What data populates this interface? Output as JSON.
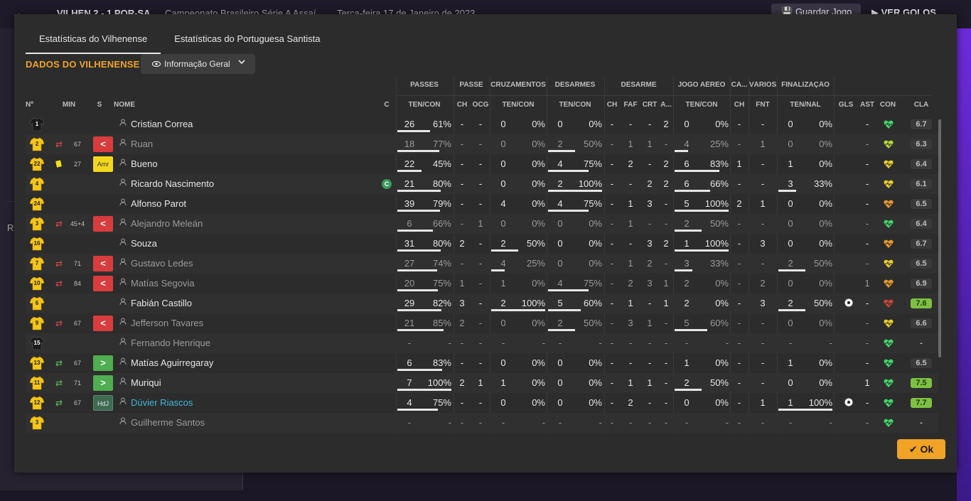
{
  "app": {
    "back_label": "←",
    "score": "VILHEN   2 - 1   POR-SA",
    "competition": "Campeonato Brasileiro Série A Assaí",
    "date": "Terça-feira 17 de Janeiro de 2023",
    "save_label": "Guardar Jogo",
    "goals_label": "VER GOLOS",
    "left_letter": "R"
  },
  "tabs": [
    "Estatísticas do Vilhenense",
    "Estatísticas do Portuguesa Santista"
  ],
  "section_title": "DADOS DO VILHENENSE",
  "view_dropdown": {
    "label": "Informação Geral",
    "icon": "eye-icon"
  },
  "groups": {
    "passes": "PASSES",
    "passe": "PASSE",
    "cruzamentos": "CRUZAMENTOS",
    "desarmes": "DESARMES",
    "desarme": "DESARME",
    "jogo_aereo": "JOGO AÉREO",
    "ca": "CA...",
    "varios": "VÁRIOS",
    "finalizacao": "FINALIZAÇÃO"
  },
  "columns": {
    "num": "Nº",
    "min": "MIN",
    "s": "S",
    "nome": "NOME",
    "c": "C",
    "pass_tc": "TEN/CON",
    "pass_ch": "CH",
    "pass_ocg": "OCG",
    "cruz_tc": "TEN/CON",
    "des_tc": "TEN/CON",
    "des_ch": "CH",
    "des_faf": "FAF",
    "des_crt": "CRT",
    "des_a": "A...",
    "aer_tc": "TEN/CON",
    "ca_ch": "CH",
    "var_fnt": "FNT",
    "fin_tn": "TEN/NAL",
    "gls": "GLS",
    "ast": "AST",
    "con": "CON",
    "cla": "CLA"
  },
  "rows": [
    {
      "num": "1",
      "gk": true,
      "sub": "",
      "min": "",
      "badge": "",
      "badge_label": "",
      "name": "Cristian Correa",
      "c": "",
      "dim": false,
      "link": false,
      "p": [
        "26",
        "61%",
        0.61
      ],
      "pch": "-",
      "pocg": "-",
      "cr": [
        "0",
        "0%",
        0
      ],
      "de": [
        "0",
        "0%",
        0
      ],
      "dch": "-",
      "faf": "-",
      "crt": "-",
      "da": "2",
      "ae": [
        "0",
        "0%",
        0
      ],
      "cach": "-",
      "fnt": "-",
      "fi": [
        "0",
        "0%",
        0
      ],
      "gls": "",
      "ast": "-",
      "con": "green",
      "cla": "6.7",
      "hi": false
    },
    {
      "num": "2",
      "gk": false,
      "sub": "out",
      "min": "67",
      "badge": "out",
      "badge_label": "<",
      "name": "Ruan",
      "c": "",
      "dim": true,
      "link": false,
      "p": [
        "18",
        "77%",
        0.77
      ],
      "pch": "-",
      "pocg": "-",
      "cr": [
        "0",
        "0%",
        0
      ],
      "de": [
        "2",
        "50%",
        0.5
      ],
      "dch": "-",
      "faf": "1",
      "crt": "1",
      "da": "-",
      "ae": [
        "4",
        "25%",
        0.25
      ],
      "cach": "-",
      "fnt": "1",
      "fi": [
        "0",
        "0%",
        0
      ],
      "gls": "",
      "ast": "-",
      "con": "yellowgreen",
      "cla": "6.3",
      "hi": false
    },
    {
      "num": "22",
      "gk": false,
      "sub": "yellow",
      "min": "27",
      "badge": "amr",
      "badge_label": "Amr",
      "name": "Bueno",
      "c": "",
      "dim": false,
      "link": false,
      "p": [
        "22",
        "45%",
        0.45
      ],
      "pch": "-",
      "pocg": "-",
      "cr": [
        "0",
        "0%",
        0
      ],
      "de": [
        "4",
        "75%",
        0.75
      ],
      "dch": "-",
      "faf": "2",
      "crt": "-",
      "da": "2",
      "ae": [
        "6",
        "83%",
        0.83
      ],
      "cach": "1",
      "fnt": "-",
      "fi": [
        "1",
        "0%",
        0
      ],
      "gls": "",
      "ast": "-",
      "con": "yellow",
      "cla": "6.4",
      "hi": false
    },
    {
      "num": "4",
      "gk": false,
      "sub": "",
      "min": "",
      "badge": "",
      "badge_label": "",
      "name": "Ricardo Nascimento",
      "c": "C",
      "dim": false,
      "link": false,
      "p": [
        "21",
        "80%",
        0.8
      ],
      "pch": "-",
      "pocg": "-",
      "cr": [
        "0",
        "0%",
        0
      ],
      "de": [
        "2",
        "100%",
        1
      ],
      "dch": "-",
      "faf": "-",
      "crt": "2",
      "da": "2",
      "ae": [
        "6",
        "66%",
        0.66
      ],
      "cach": "-",
      "fnt": "-",
      "fi": [
        "3",
        "33%",
        0.33
      ],
      "gls": "",
      "ast": "-",
      "con": "yellow",
      "cla": "6.1",
      "hi": false
    },
    {
      "num": "24",
      "gk": false,
      "sub": "",
      "min": "",
      "badge": "",
      "badge_label": "",
      "name": "Alfonso Parot",
      "c": "",
      "dim": false,
      "link": false,
      "p": [
        "39",
        "79%",
        0.79
      ],
      "pch": "-",
      "pocg": "-",
      "cr": [
        "4",
        "0%",
        0
      ],
      "de": [
        "4",
        "75%",
        0.75
      ],
      "dch": "-",
      "faf": "1",
      "crt": "3",
      "da": "-",
      "ae": [
        "5",
        "100%",
        1
      ],
      "cach": "2",
      "fnt": "1",
      "fi": [
        "0",
        "0%",
        0
      ],
      "gls": "",
      "ast": "-",
      "con": "orange",
      "cla": "6.5",
      "hi": false
    },
    {
      "num": "3",
      "gk": false,
      "sub": "out",
      "min": "45+4",
      "badge": "out",
      "badge_label": "<",
      "name": "Alejandro Meleán",
      "c": "",
      "dim": true,
      "link": false,
      "p": [
        "6",
        "66%",
        0.66
      ],
      "pch": "-",
      "pocg": "1",
      "cr": [
        "0",
        "0%",
        0
      ],
      "de": [
        "0",
        "0%",
        0
      ],
      "dch": "-",
      "faf": "1",
      "crt": "-",
      "da": "-",
      "ae": [
        "2",
        "50%",
        0.5
      ],
      "cach": "-",
      "fnt": "-",
      "fi": [
        "0",
        "0%",
        0
      ],
      "gls": "",
      "ast": "-",
      "con": "green",
      "cla": "6.4",
      "hi": false
    },
    {
      "num": "16",
      "gk": false,
      "sub": "",
      "min": "",
      "badge": "",
      "badge_label": "",
      "name": "Souza",
      "c": "",
      "dim": false,
      "link": false,
      "p": [
        "31",
        "80%",
        0.8
      ],
      "pch": "2",
      "pocg": "-",
      "cr": [
        "2",
        "50%",
        0.5
      ],
      "de": [
        "0",
        "0%",
        0
      ],
      "dch": "-",
      "faf": "-",
      "crt": "3",
      "da": "2",
      "ae": [
        "1",
        "100%",
        1
      ],
      "cach": "-",
      "fnt": "3",
      "fi": [
        "0",
        "0%",
        0
      ],
      "gls": "",
      "ast": "-",
      "con": "orange",
      "cla": "6.7",
      "hi": false
    },
    {
      "num": "7",
      "gk": false,
      "sub": "out",
      "min": "71",
      "badge": "out",
      "badge_label": "<",
      "name": "Gustavo Ledes",
      "c": "",
      "dim": true,
      "link": false,
      "p": [
        "27",
        "74%",
        0.74
      ],
      "pch": "-",
      "pocg": "-",
      "cr": [
        "4",
        "25%",
        0.25
      ],
      "de": [
        "0",
        "0%",
        0
      ],
      "dch": "-",
      "faf": "1",
      "crt": "2",
      "da": "-",
      "ae": [
        "3",
        "33%",
        0.33
      ],
      "cach": "-",
      "fnt": "-",
      "fi": [
        "2",
        "50%",
        0.5
      ],
      "gls": "",
      "ast": "-",
      "con": "yellow",
      "cla": "6.5",
      "hi": false
    },
    {
      "num": "10",
      "gk": false,
      "sub": "out",
      "min": "84",
      "badge": "out",
      "badge_label": "<",
      "name": "Matías Segovia",
      "c": "",
      "dim": true,
      "link": false,
      "p": [
        "20",
        "75%",
        0.75
      ],
      "pch": "1",
      "pocg": "-",
      "cr": [
        "1",
        "0%",
        0
      ],
      "de": [
        "4",
        "75%",
        0.75
      ],
      "dch": "-",
      "faf": "2",
      "crt": "3",
      "da": "1",
      "ae": [
        "2",
        "0%",
        0
      ],
      "cach": "-",
      "fnt": "2",
      "fi": [
        "0",
        "0%",
        0
      ],
      "gls": "",
      "ast": "1",
      "con": "orange",
      "cla": "6.9",
      "hi": false
    },
    {
      "num": "6",
      "gk": false,
      "sub": "",
      "min": "",
      "badge": "",
      "badge_label": "",
      "name": "Fabián Castillo",
      "c": "",
      "dim": false,
      "link": false,
      "p": [
        "29",
        "82%",
        0.82
      ],
      "pch": "3",
      "pocg": "-",
      "cr": [
        "2",
        "100%",
        1
      ],
      "de": [
        "5",
        "60%",
        0.6
      ],
      "dch": "-",
      "faf": "1",
      "crt": "-",
      "da": "1",
      "ae": [
        "2",
        "0%",
        0
      ],
      "cach": "-",
      "fnt": "3",
      "fi": [
        "2",
        "50%",
        0.5
      ],
      "gls": "ball",
      "ast": "-",
      "con": "red",
      "cla": "7.6",
      "hi": true
    },
    {
      "num": "9",
      "gk": false,
      "sub": "out",
      "min": "67",
      "badge": "out",
      "badge_label": "<",
      "name": "Jefferson Tavares",
      "c": "",
      "dim": true,
      "link": false,
      "p": [
        "21",
        "85%",
        0.85
      ],
      "pch": "2",
      "pocg": "-",
      "cr": [
        "0",
        "0%",
        0
      ],
      "de": [
        "2",
        "50%",
        0.5
      ],
      "dch": "-",
      "faf": "3",
      "crt": "1",
      "da": "-",
      "ae": [
        "5",
        "60%",
        0.6
      ],
      "cach": "-",
      "fnt": "-",
      "fi": [
        "0",
        "0%",
        0
      ],
      "gls": "",
      "ast": "-",
      "con": "yellow",
      "cla": "6.6",
      "hi": false
    },
    {
      "num": "15",
      "gk": true,
      "sub": "",
      "min": "",
      "badge": "",
      "badge_label": "",
      "name": "Fernando Henrique",
      "c": "",
      "dim": true,
      "link": false,
      "p": [
        "-",
        "-",
        0
      ],
      "pch": "-",
      "pocg": "-",
      "cr": [
        "-",
        "-",
        0
      ],
      "de": [
        "-",
        "-",
        0
      ],
      "dch": "-",
      "faf": "-",
      "crt": "-",
      "da": "-",
      "ae": [
        "-",
        "-",
        0
      ],
      "cach": "-",
      "fnt": "-",
      "fi": [
        "-",
        "-",
        0
      ],
      "gls": "",
      "ast": "-",
      "con": "green",
      "cla": "-",
      "hi": false
    },
    {
      "num": "13",
      "gk": false,
      "sub": "in",
      "min": "67",
      "badge": "in",
      "badge_label": ">",
      "name": "Matías Aguirregaray",
      "c": "",
      "dim": false,
      "link": false,
      "p": [
        "6",
        "83%",
        0.83
      ],
      "pch": "-",
      "pocg": "-",
      "cr": [
        "0",
        "0%",
        0
      ],
      "de": [
        "0",
        "0%",
        0
      ],
      "dch": "-",
      "faf": "-",
      "crt": "-",
      "da": "-",
      "ae": [
        "1",
        "0%",
        0
      ],
      "cach": "-",
      "fnt": "-",
      "fi": [
        "1",
        "0%",
        0
      ],
      "gls": "",
      "ast": "-",
      "con": "green",
      "cla": "6.5",
      "hi": false
    },
    {
      "num": "11",
      "gk": false,
      "sub": "in",
      "min": "71",
      "badge": "in",
      "badge_label": ">",
      "name": "Muriqui",
      "c": "",
      "dim": false,
      "link": false,
      "p": [
        "7",
        "100%",
        1
      ],
      "pch": "2",
      "pocg": "1",
      "cr": [
        "1",
        "0%",
        0
      ],
      "de": [
        "0",
        "0%",
        0
      ],
      "dch": "-",
      "faf": "1",
      "crt": "1",
      "da": "-",
      "ae": [
        "2",
        "50%",
        0.5
      ],
      "cach": "-",
      "fnt": "-",
      "fi": [
        "0",
        "0%",
        0
      ],
      "gls": "",
      "ast": "1",
      "con": "green",
      "cla": "7.5",
      "hi": true
    },
    {
      "num": "12",
      "gk": false,
      "sub": "in",
      "min": "67",
      "badge": "hdj",
      "badge_label": "HdJ",
      "name": "Dúvier Riascos",
      "c": "",
      "dim": false,
      "link": true,
      "p": [
        "4",
        "75%",
        0.75
      ],
      "pch": "-",
      "pocg": "-",
      "cr": [
        "0",
        "0%",
        0
      ],
      "de": [
        "0",
        "0%",
        0
      ],
      "dch": "-",
      "faf": "2",
      "crt": "-",
      "da": "-",
      "ae": [
        "0",
        "0%",
        0
      ],
      "cach": "-",
      "fnt": "1",
      "fi": [
        "1",
        "100%",
        1
      ],
      "gls": "ball",
      "ast": "-",
      "con": "green",
      "cla": "7.7",
      "hi": true
    },
    {
      "num": "3",
      "gk": false,
      "sub": "",
      "min": "",
      "badge": "",
      "badge_label": "",
      "name": "Guilherme Santos",
      "c": "",
      "dim": true,
      "link": false,
      "p": [
        "-",
        "-",
        0
      ],
      "pch": "-",
      "pocg": "-",
      "cr": [
        "-",
        "-",
        0
      ],
      "de": [
        "-",
        "-",
        0
      ],
      "dch": "-",
      "faf": "-",
      "crt": "-",
      "da": "-",
      "ae": [
        "-",
        "-",
        0
      ],
      "cach": "-",
      "fnt": "-",
      "fi": [
        "-",
        "-",
        0
      ],
      "gls": "",
      "ast": "-",
      "con": "green",
      "cla": "-",
      "hi": false
    }
  ],
  "ok_label": "Ok",
  "colors": {
    "accent": "#f0a324",
    "rating_high": "#7ec142",
    "sub_out": "#d83c3c",
    "sub_in": "#4fae4f",
    "con_green": "#3fd46a",
    "con_yellowgreen": "#b5d63a",
    "con_yellow": "#e8cc2a",
    "con_orange": "#e89a2a",
    "con_red": "#c9443a"
  }
}
